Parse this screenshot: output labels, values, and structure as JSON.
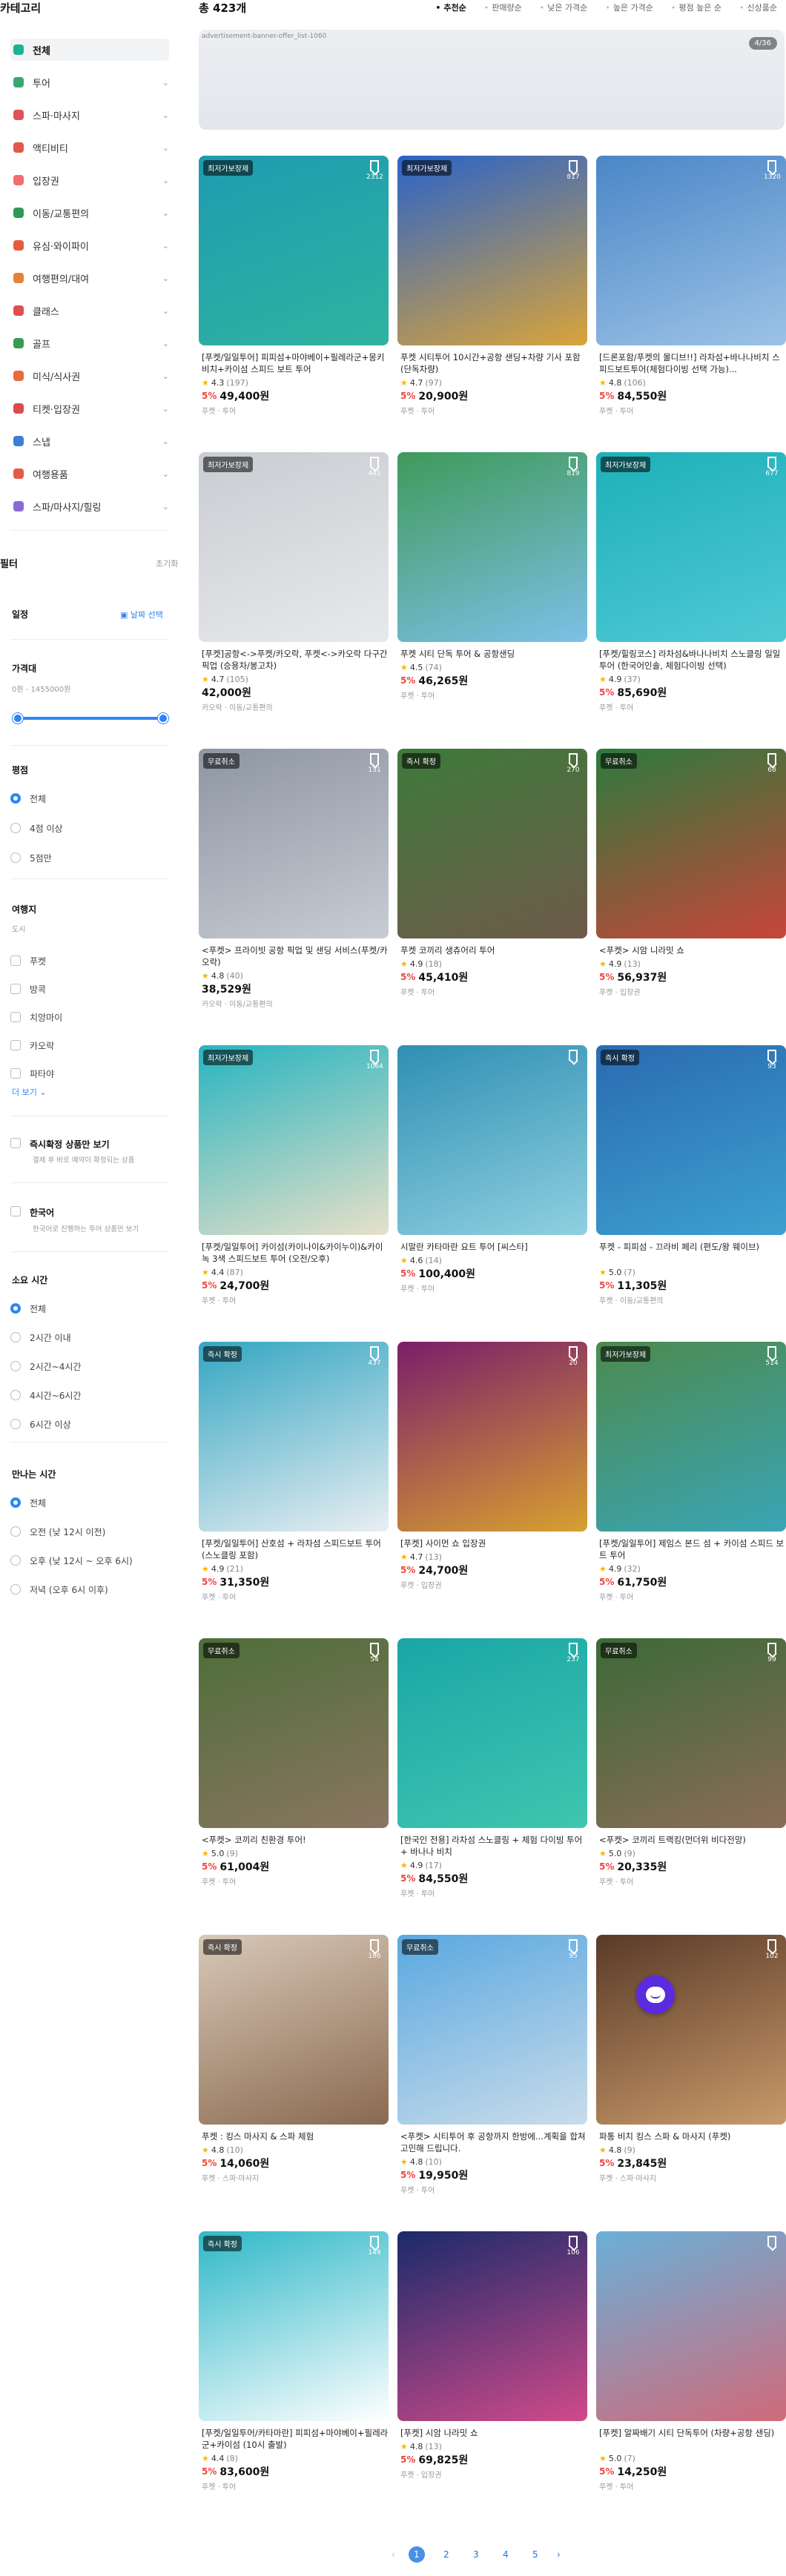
{
  "sidebar": {
    "title": "카테고리",
    "categories": [
      {
        "label": "전체",
        "color": "#19b394"
      },
      {
        "label": "투어",
        "color": "#3aa76d"
      },
      {
        "label": "스파·마사지",
        "color": "#e1525a"
      },
      {
        "label": "액티비티",
        "color": "#e2574c"
      },
      {
        "label": "입장권",
        "color": "#f26d6d"
      },
      {
        "label": "이동/교통편의",
        "color": "#2e9a56"
      },
      {
        "label": "유심·와이파이",
        "color": "#e65c3a"
      },
      {
        "label": "여행편의/대여",
        "color": "#e6823a"
      },
      {
        "label": "클래스",
        "color": "#e04e4e"
      },
      {
        "label": "골프",
        "color": "#3a9b52"
      },
      {
        "label": "미식/식사권",
        "color": "#e96a3a"
      },
      {
        "label": "티켓·입장권",
        "color": "#d94c4c"
      },
      {
        "label": "스냅",
        "color": "#3c7dd9"
      },
      {
        "label": "여행용품",
        "color": "#e55a46"
      },
      {
        "label": "스파/마사지/힐링",
        "color": "#8a6ad6"
      }
    ],
    "filter_title": "필터",
    "filter_reset": "초기화",
    "schedule": {
      "label": "일정",
      "select": "날짜 선택"
    },
    "price": {
      "label": "가격대",
      "range": "0원 - 1455000원"
    },
    "rating": {
      "label": "평점",
      "options": [
        "전체",
        "4점 이상",
        "5점만"
      ],
      "selected": 0
    },
    "companion": {
      "label": "여행지",
      "sub": "도시",
      "options": [
        "푸켓",
        "방콕",
        "치앙마이",
        "카오락",
        "파타야"
      ],
      "more": "더 보기 ⌄"
    },
    "instant": {
      "label": "즉시확정 상품만 보기",
      "sub": "결제 후 바로 예약이 확정되는 상품"
    },
    "korean": {
      "label": "한국어",
      "sub": "한국어로 진행하는 투어 상품만 보기"
    },
    "duration": {
      "label": "소요 시간",
      "options": [
        "전체",
        "2시간 이내",
        "2시간~4시간",
        "4시간~6시간",
        "6시간 이상"
      ],
      "selected": 0
    },
    "meet": {
      "label": "만나는 시간",
      "options": [
        "전체",
        "오전 (낮 12시 이전)",
        "오후 (낮 12시 ~ 오후 6시)",
        "저녁 (오후 6시 이후)"
      ],
      "selected": 0
    }
  },
  "main": {
    "total": "총 423개",
    "sorts": [
      "추천순",
      "판매량순",
      "낮은 가격순",
      "높은 가격순",
      "평점 높은 순",
      "신상품순"
    ],
    "sort_selected": 0,
    "banner_alt": "advertisement-banner-offer_list-1060",
    "banner_count": "4/36"
  },
  "products": [
    {
      "badge": "최저가보장제",
      "saves": "2312",
      "title": "[푸켓/일일투어] 피피섬+마야베이+필레라군+몽키비치+카이섬 스피드 보트 투어",
      "rating": "4.3",
      "reviews": "(197)",
      "pct": "5%",
      "price": "49,400원",
      "loc": "푸켓 · 투어",
      "c1": "#1f9bb0",
      "c2": "#2fb3a0"
    },
    {
      "badge": "최저가보장제",
      "saves": "817",
      "title": "푸켓 시티투어 10시간+공항 샌딩+차량 기사 포함(단독차량)",
      "rating": "4.7",
      "reviews": "(97)",
      "pct": "5%",
      "price": "20,900원",
      "loc": "푸켓 · 투어",
      "c1": "#2a63c9",
      "c2": "#d9a43a"
    },
    {
      "badge": "",
      "saves": "1320",
      "title": "[드론포함/푸켓의 몰디브!!] 라차섬+바나나비치 스피드보트투어(체험다이빙 선택 가능)...",
      "rating": "4.8",
      "reviews": "(106)",
      "pct": "5%",
      "price": "84,550원",
      "loc": "푸켓 · 투어",
      "c1": "#4a86c7",
      "c2": "#9cc3e6"
    },
    {
      "badge": "최저가보장제",
      "saves": "441",
      "title": "[푸켓]공항<->푸켓/카오락, 푸켓<->카오락 다구간 픽업 (승용차/봉고차)",
      "rating": "4.7",
      "reviews": "(105)",
      "pct": "",
      "price": "42,000원",
      "loc": "카오락 · 이동/교통편의",
      "c1": "#c9ccd1",
      "c2": "#e8e9ec"
    },
    {
      "badge": "",
      "saves": "819",
      "title": "푸켓 시티 단독 투어 & 공항샌딩",
      "rating": "4.5",
      "reviews": "(74)",
      "pct": "5%",
      "price": "46,265원",
      "loc": "푸켓 · 투어",
      "c1": "#3f9a5a",
      "c2": "#7cc0e8"
    },
    {
      "badge": "최저가보장제",
      "saves": "677",
      "title": "[푸켓/힐링코스] 라차섬&바나나비치 스노클링 일일투어 (한국어인솔, 체험다이빙 선택)",
      "rating": "4.9",
      "reviews": "(37)",
      "pct": "5%",
      "price": "85,690원",
      "loc": "푸켓 · 투어",
      "c1": "#1eb0b8",
      "c2": "#4fc9d6"
    },
    {
      "badge": "무료취소",
      "saves": "131",
      "title": "<푸켓> 프라이빗 공항 픽업 및 샌딩 서비스(푸켓/카오락)",
      "rating": "4.8",
      "reviews": "(40)",
      "pct": "",
      "price": "38,529원",
      "loc": "카오락 · 이동/교통편의",
      "c1": "#8e96a3",
      "c2": "#c7ccd4"
    },
    {
      "badge": "즉시 확정",
      "saves": "270",
      "title": "푸켓 코끼리 생츄어리 투어",
      "rating": "4.9",
      "reviews": "(18)",
      "pct": "5%",
      "price": "45,410원",
      "loc": "푸켓 · 투어",
      "c1": "#3e7a3a",
      "c2": "#6e5a4a"
    },
    {
      "badge": "무료취소",
      "saves": "68",
      "title": "<푸켓> 시암 니라밋 쇼",
      "rating": "4.9",
      "reviews": "(13)",
      "pct": "5%",
      "price": "56,937원",
      "loc": "푸켓 · 입장권",
      "c1": "#2c7a3c",
      "c2": "#c8453a"
    },
    {
      "badge": "최저가보장제",
      "saves": "1064",
      "title": "[푸켓/일일투어] 카이섬(카이나이&카이누이)&카이녹 3색 스피드보트 투어 (오전/오후)",
      "rating": "4.4",
      "reviews": "(87)",
      "pct": "5%",
      "price": "24,700원",
      "loc": "푸켓 · 투어",
      "c1": "#28b4c0",
      "c2": "#e7e0c8"
    },
    {
      "badge": "",
      "saves": "",
      "title": "시말란 카타마란 요트 투어 [씨스타]",
      "rating": "4.6",
      "reviews": "(14)",
      "pct": "5%",
      "price": "100,400원",
      "loc": "푸켓 · 투어",
      "c1": "#2f8fb3",
      "c2": "#8fd0e0"
    },
    {
      "badge": "즉시 확정",
      "saves": "93",
      "title": "푸켓 - 피피섬 - 끄라비 페리 (편도/왕 웨이브)",
      "rating": "5.0",
      "reviews": "(7)",
      "pct": "5%",
      "price": "11,305원",
      "loc": "푸켓 · 이동/교통편의",
      "c1": "#2a6bb0",
      "c2": "#3da0d0"
    },
    {
      "badge": "즉시 확정",
      "saves": "437",
      "title": "[푸켓/일일투어] 산호섬 + 라차섬 스피드보트 투어 (스노클링 포함)",
      "rating": "4.9",
      "reviews": "(21)",
      "pct": "5%",
      "price": "31,350원",
      "loc": "푸켓 · 투어",
      "c1": "#35a6c2",
      "c2": "#e9eef2"
    },
    {
      "badge": "",
      "saves": "20",
      "title": "[푸켓] 사이먼 쇼 입장권",
      "rating": "4.7",
      "reviews": "(13)",
      "pct": "5%",
      "price": "24,700원",
      "loc": "푸켓 · 입장권",
      "c1": "#7a1e6a",
      "c2": "#d8a030"
    },
    {
      "badge": "최저가보장제",
      "saves": "514",
      "title": "[푸켓/일일투어] 제임스 본드 섬 + 카이섬 스피드 보트 투어",
      "rating": "4.9",
      "reviews": "(32)",
      "pct": "5%",
      "price": "61,750원",
      "loc": "푸켓 · 투어",
      "c1": "#4c8a4e",
      "c2": "#3aa5b5"
    },
    {
      "badge": "무료취소",
      "saves": "54",
      "title": "<푸켓> 코끼리 친환경 투어!",
      "rating": "5.0",
      "reviews": "(9)",
      "pct": "5%",
      "price": "61,004원",
      "loc": "푸켓 · 투어",
      "c1": "#4e6e3a",
      "c2": "#8a7560"
    },
    {
      "badge": "",
      "saves": "237",
      "title": "[한국인 전용] 라차섬 스노클링 + 체험 다이빙 투어 + 바나나 비치",
      "rating": "4.9",
      "reviews": "(17)",
      "pct": "5%",
      "price": "84,550원",
      "loc": "푸켓 · 투어",
      "c1": "#1aa6a6",
      "c2": "#3fc6b0"
    },
    {
      "badge": "무료취소",
      "saves": "99",
      "title": "<푸켓> 코끼리 트랙킹(먼더위 비다전망)",
      "rating": "5.0",
      "reviews": "(9)",
      "pct": "5%",
      "price": "20,335원",
      "loc": "푸켓 · 투어",
      "c1": "#3c6a38",
      "c2": "#8a6b58"
    },
    {
      "badge": "즉시 확정",
      "saves": "186",
      "title": "푸켓 : 킹스 마사지 & 스파 체험",
      "rating": "4.8",
      "reviews": "(10)",
      "pct": "5%",
      "price": "14,060원",
      "loc": "푸켓 · 스파·마사지",
      "c1": "#d8c8b8",
      "c2": "#8a6a50"
    },
    {
      "badge": "무료취소",
      "saves": "95",
      "title": "<푸켓> 시티투어 후 공항까지 한방에...계획을 합쳐 고민해 드립니다.",
      "rating": "4.8",
      "reviews": "(10)",
      "pct": "5%",
      "price": "19,950원",
      "loc": "푸켓 · 투어",
      "c1": "#5aa8e0",
      "c2": "#c9dcea"
    },
    {
      "badge": "",
      "saves": "102",
      "title": "파통 비치 킹스 스파 & 마사지 (푸켓)",
      "rating": "4.8",
      "reviews": "(9)",
      "pct": "5%",
      "price": "23,845원",
      "loc": "푸켓 · 스파·마사지",
      "c1": "#5a3a28",
      "c2": "#c89a6a"
    },
    {
      "badge": "즉시 확정",
      "saves": "149",
      "title": "[푸켓/일일투어/카타마란] 피피섬+마야베이+필레라군+카이섬 (10시 출발)",
      "rating": "4.4",
      "reviews": "(8)",
      "pct": "5%",
      "price": "83,600원",
      "loc": "푸켓 · 투어",
      "c1": "#2fb8c8",
      "c2": "#ffffff"
    },
    {
      "badge": "",
      "saves": "106",
      "title": "[푸켓] 시암 나라밋 쇼",
      "rating": "4.8",
      "reviews": "(13)",
      "pct": "5%",
      "price": "69,825원",
      "loc": "푸켓 · 입장권",
      "c1": "#1a2a6a",
      "c2": "#d04a8a"
    },
    {
      "badge": "",
      "saves": "",
      "title": "[푸켓] 알짜배기 시티 단독투어 (차량+공항 샌딩)",
      "rating": "5.0",
      "reviews": "(7)",
      "pct": "5%",
      "price": "14,250원",
      "loc": "푸켓 · 투어",
      "c1": "#6ab0d8",
      "c2": "#d06a7a"
    }
  ],
  "pagination": {
    "pages": [
      "1",
      "2",
      "3",
      "4",
      "5"
    ],
    "current": 0,
    "prev": "‹",
    "next": "›"
  }
}
